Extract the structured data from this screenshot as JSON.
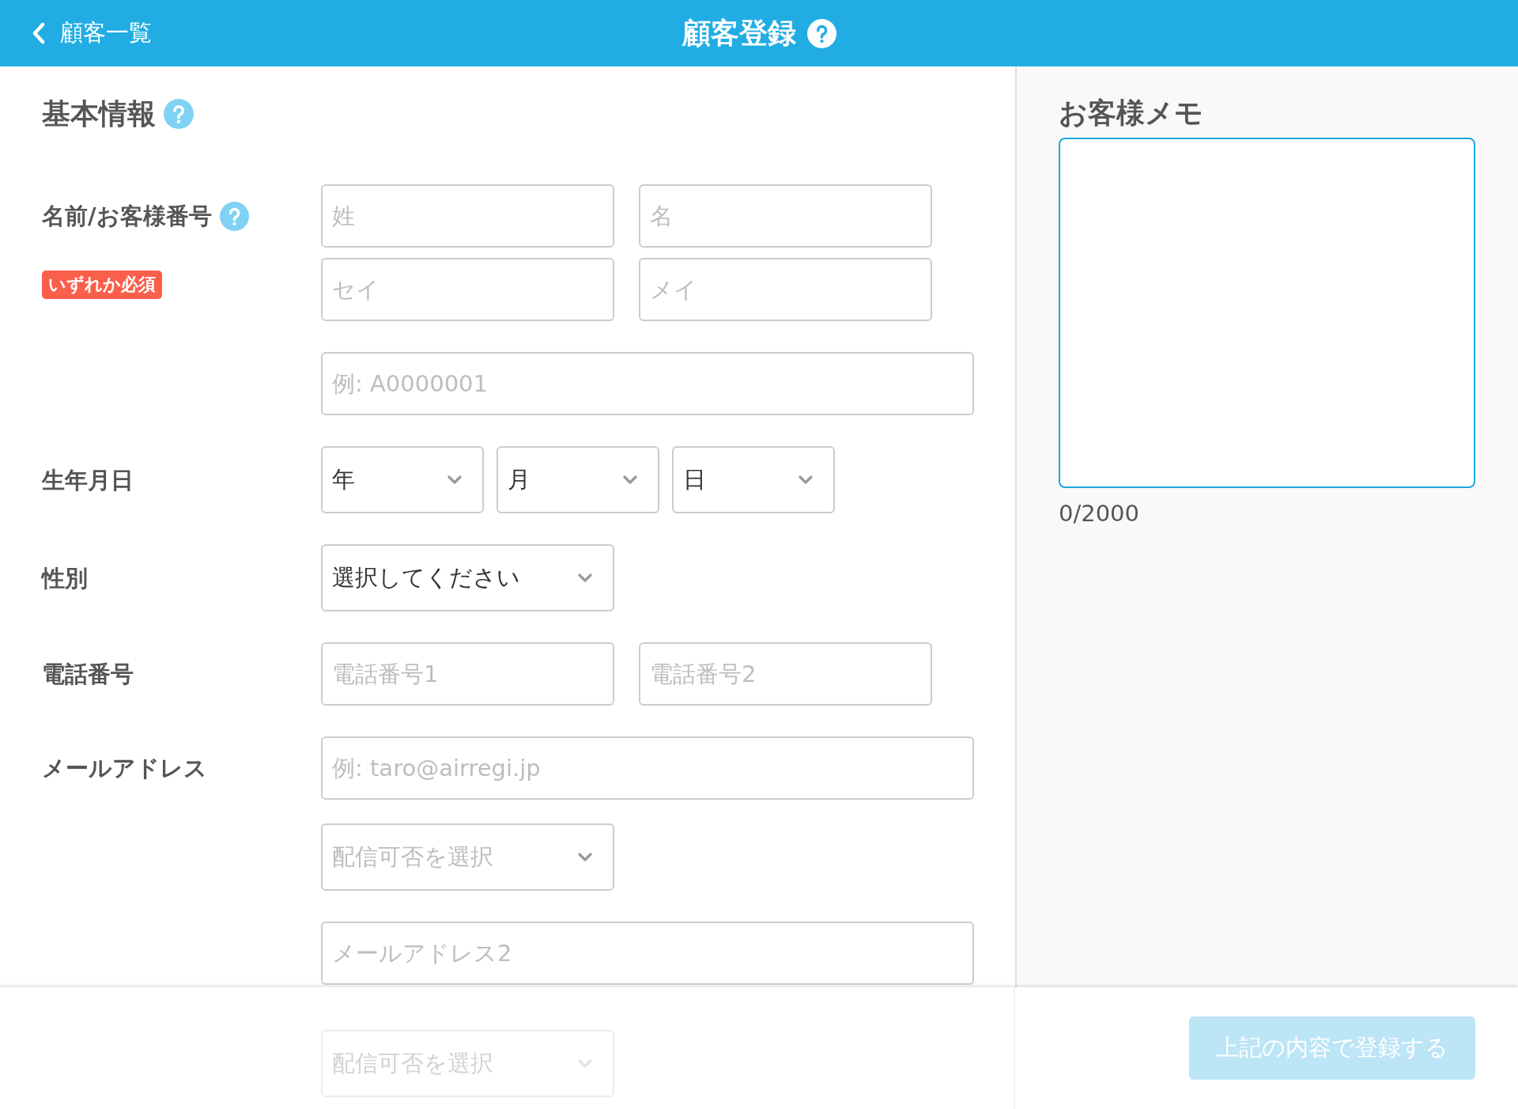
{
  "header": {
    "back_label": "顧客一覧",
    "title": "顧客登録",
    "help": true
  },
  "basic_info": {
    "heading": "基本情報",
    "help": true,
    "rows": [
      {
        "label": "名前/お客様番号",
        "help": true,
        "badge": "いずれか必須",
        "lines": [
          [
            {
              "kind": "input",
              "placeholder": "姓"
            },
            {
              "kind": "input",
              "placeholder": "名"
            }
          ],
          [
            {
              "kind": "input",
              "placeholder": "セイ"
            },
            {
              "kind": "input",
              "placeholder": "メイ"
            }
          ]
        ]
      },
      {
        "lines": [
          [
            {
              "kind": "input",
              "placeholder": "例: A0000001"
            }
          ]
        ]
      },
      {
        "label": "生年月日",
        "lines": [
          [
            {
              "kind": "select",
              "value": "年"
            },
            {
              "kind": "select",
              "value": "月"
            },
            {
              "kind": "select",
              "value": "日"
            }
          ]
        ]
      },
      {
        "label": "性別",
        "lines": [
          [
            {
              "kind": "select",
              "value": "選択してください"
            }
          ]
        ]
      },
      {
        "label": "電話番号",
        "lines": [
          [
            {
              "kind": "input",
              "placeholder": "電話番号1"
            },
            {
              "kind": "input",
              "placeholder": "電話番号2"
            }
          ]
        ]
      },
      {
        "label": "メールアドレス",
        "lines": [
          [
            {
              "kind": "input",
              "placeholder": "例: taro@airregi.jp"
            }
          ],
          [
            {
              "kind": "select",
              "placeholder": "配信可否を選択"
            }
          ]
        ]
      },
      {
        "lines": [
          [
            {
              "kind": "input",
              "placeholder": "メールアドレス2"
            }
          ],
          [
            {
              "kind": "select",
              "placeholder": "配信可否を選択",
              "faded": true
            }
          ]
        ]
      }
    ]
  },
  "memo": {
    "heading": "お客様メモ",
    "focused": true,
    "counter": "0/2000"
  },
  "footer": {
    "submit": {
      "label": "上記の内容で登録する",
      "disabled": true
    }
  }
}
